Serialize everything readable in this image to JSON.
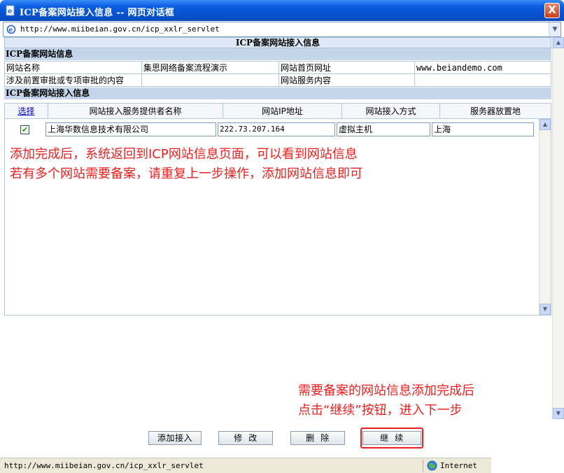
{
  "window": {
    "title": "ICP备案网站接入信息 -- 网页对话框",
    "close_label": "X"
  },
  "address": {
    "url": "http://www.miibeian.gov.cn/icp_xxlr_servlet"
  },
  "page": {
    "heading": "ICP备案网站接入信息",
    "site_info_header": "ICP备案网站信息",
    "site_info": {
      "name_label": "网站名称",
      "name_value": "集思网络备案流程演示",
      "home_label": "网站首页网址",
      "home_value": "www.beiandemo.com",
      "approval_label": "涉及前置审批或专项审批的内容",
      "approval_value": "",
      "service_label": "网站服务内容",
      "service_value": ""
    },
    "access_header": "ICP备案网站接入信息",
    "columns": [
      "选择",
      "网站接入服务提供者名称",
      "网站IP地址",
      "网站接入方式",
      "服务器放置地"
    ],
    "rows": [
      {
        "checked": true,
        "check_glyph": "✔",
        "provider": "上海华数信息技术有限公司",
        "ip": "222.73.207.164",
        "method": "虚拟主机",
        "location": "上海"
      }
    ]
  },
  "annotations": {
    "line1": "添加完成后，系统返回到ICP网站信息页面，可以看到网站信息",
    "line2": "若有多个网站需要备案，请重复上一步操作，添加网站信息即可",
    "line3": "需要备案的网站信息添加完成后",
    "line4": "点击“继续”按钮，进入下一步",
    "color": "#e8201f"
  },
  "buttons": {
    "add": "添加接入",
    "edit": "修  改",
    "delete": "删  除",
    "continue": "继  续"
  },
  "status": {
    "url": "http://www.miibeian.gov.cn/icp_xxlr_servlet",
    "zone": "Internet"
  }
}
